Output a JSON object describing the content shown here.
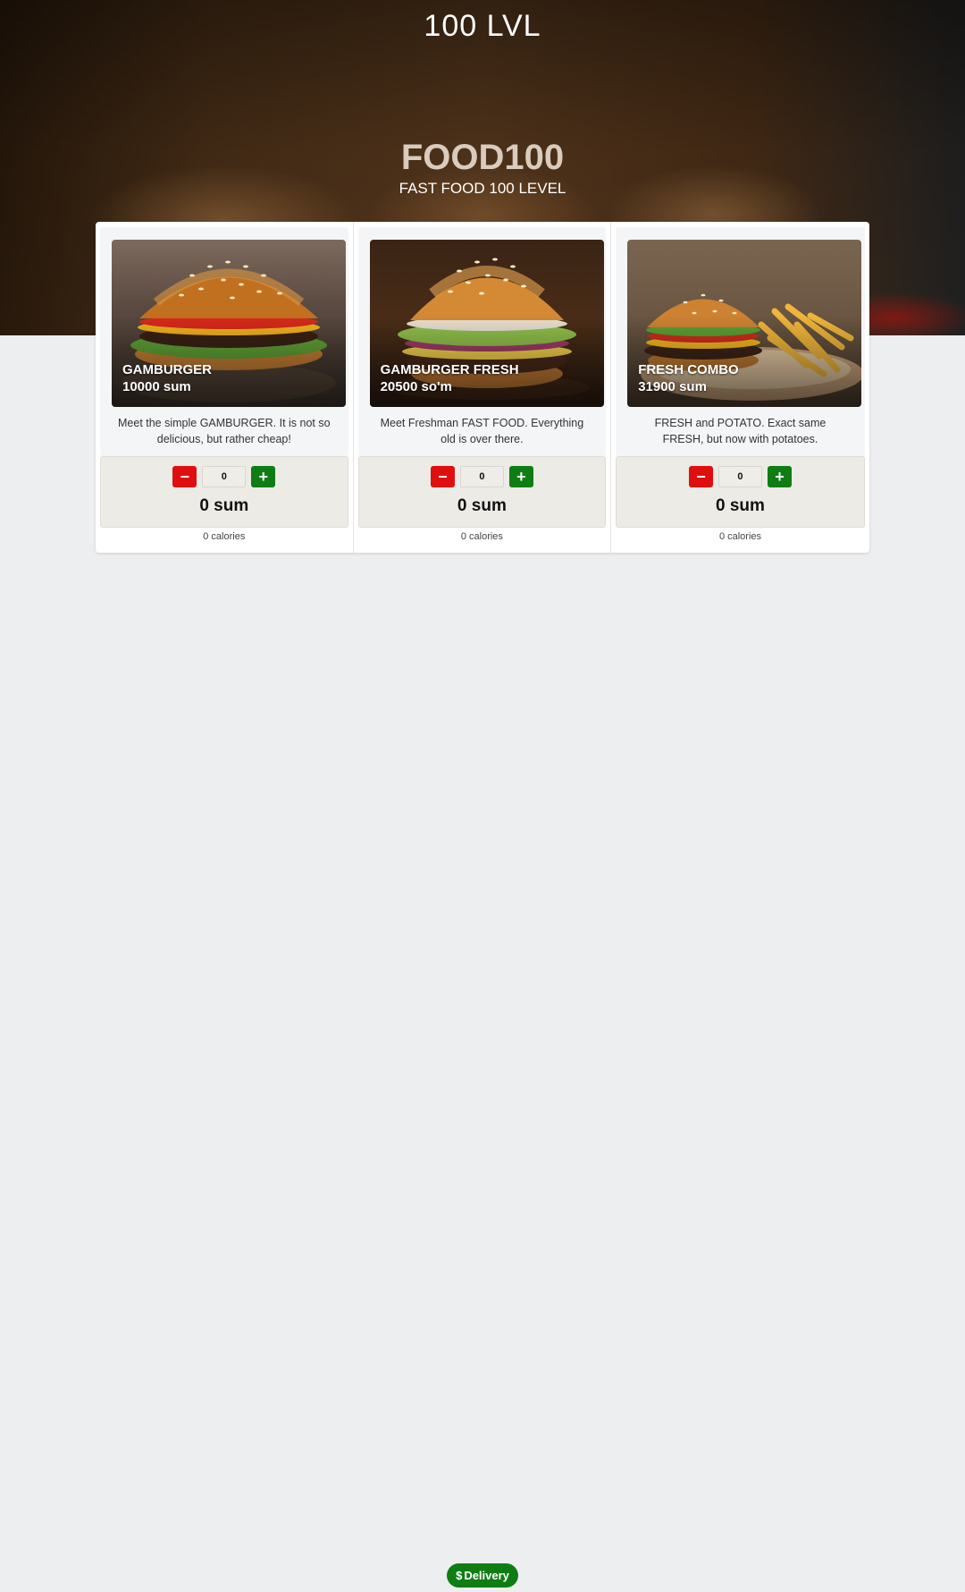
{
  "header": {
    "site_title": "100 LVL",
    "brand_title": "FOOD100",
    "brand_subtitle": "FAST FOOD 100 LEVEL"
  },
  "products": [
    {
      "name": "GAMBURGER",
      "price": "10000 sum",
      "description": "Meet the simple GAMBURGER. It is not so delicious, but rather cheap!",
      "quantity": "0",
      "total": "0 sum",
      "calories": "0 calories",
      "image_icon": "burger-photo"
    },
    {
      "name": "GAMBURGER FRESH",
      "price": "20500 so'm",
      "description": "Meet Freshman FAST FOOD. Everything old is over there.",
      "quantity": "0",
      "total": "0 sum",
      "calories": "0 calories",
      "image_icon": "burger-fresh-photo"
    },
    {
      "name": "FRESH COMBO",
      "price": "31900 sum",
      "description": "FRESH and POTATO. Exact same FRESH, but now with potatoes.",
      "quantity": "0",
      "total": "0 sum",
      "calories": "0 calories",
      "image_icon": "combo-photo"
    }
  ],
  "controls": {
    "minus_label": "−",
    "plus_label": "+"
  },
  "footer": {
    "delivery_icon": "$",
    "delivery_label": "Delivery"
  },
  "colors": {
    "minus_button": "#e00f0f",
    "plus_button": "#0f7d14",
    "delivery_button": "#0f7d14",
    "page_background": "#edeef0"
  }
}
